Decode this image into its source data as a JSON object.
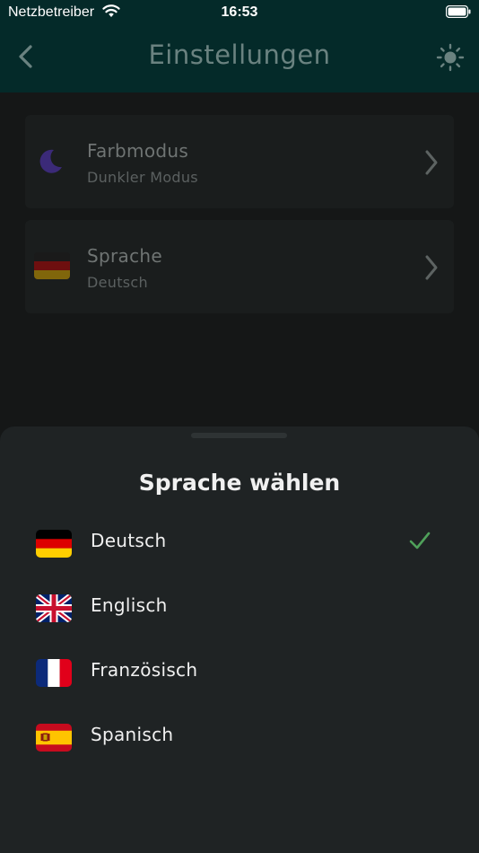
{
  "status_bar": {
    "carrier": "Netzbetreiber",
    "time": "16:53",
    "wifi_icon": "wifi-icon",
    "battery_icon": "battery-icon"
  },
  "nav": {
    "title": "Einstellungen",
    "back_icon": "chevron-left-icon",
    "theme_icon": "sun-icon"
  },
  "settings": {
    "items": [
      {
        "label": "Farbmodus",
        "value": "Dunkler Modus",
        "icon": "moon-icon"
      },
      {
        "label": "Sprache",
        "value": "Deutsch",
        "icon": "flag-de-icon"
      }
    ]
  },
  "sheet": {
    "title": "Sprache wählen",
    "languages": [
      {
        "label": "Deutsch",
        "flag": "flag-de-icon",
        "selected": true
      },
      {
        "label": "Englisch",
        "flag": "flag-gb-icon",
        "selected": false
      },
      {
        "label": "Französisch",
        "flag": "flag-fr-icon",
        "selected": false
      },
      {
        "label": "Spanisch",
        "flag": "flag-es-icon",
        "selected": false
      }
    ]
  },
  "colors": {
    "header_bg": "#042a29",
    "background": "#151717",
    "sheet_bg": "#1f2324",
    "accent_moon": "#3b2a78",
    "check": "#4fa05a"
  }
}
